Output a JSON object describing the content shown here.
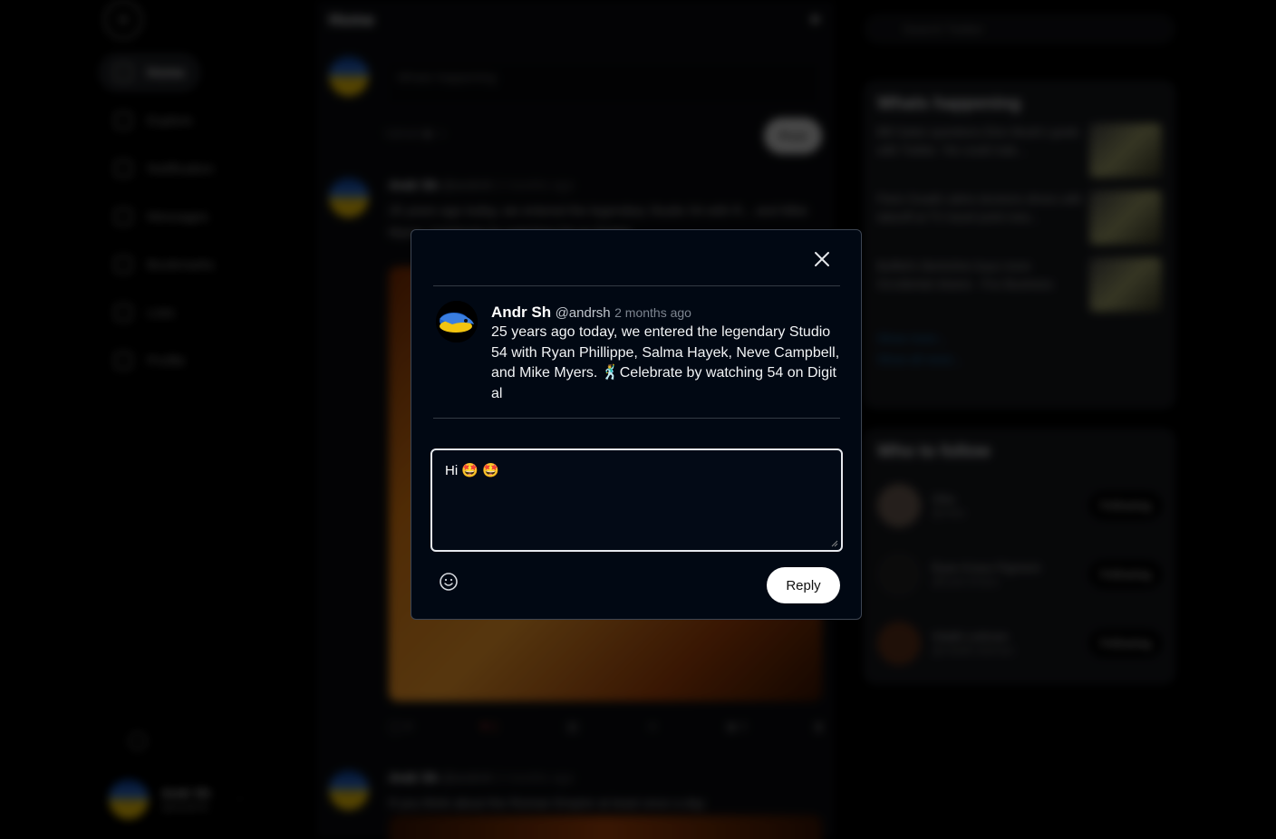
{
  "background": {
    "nav": {
      "items": [
        {
          "label": "Home",
          "icon": "home-icon"
        },
        {
          "label": "Explore",
          "icon": "hash-icon"
        },
        {
          "label": "Notification",
          "icon": "bell-icon"
        },
        {
          "label": "Messages",
          "icon": "mail-icon"
        },
        {
          "label": "Bookmarks",
          "icon": "bookmark-icon"
        },
        {
          "label": "Lists",
          "icon": "list-icon"
        },
        {
          "label": "Profile",
          "icon": "user-icon"
        }
      ],
      "account_name": "Andr Sh",
      "account_handle": "@andrsh"
    },
    "feed": {
      "title": "Home",
      "compose_placeholder": "Whats happening",
      "compose_tools_label": "Upload",
      "post_label": "Post",
      "tweet1_name": "Andr Sh",
      "tweet1_handle": "@andrsh",
      "tweet1_time": "2 months ago",
      "tweet1_text": "25 years ago today, we entered the legendary Studio 54 with R... and Mike Myers. Celebrate by watching 54 on Digital",
      "tweet1_replies": "4",
      "tweet1_likes": "1",
      "tweet1_views": "4",
      "tweet2_name": "Andr Sh",
      "tweet2_handle": "@andrsh",
      "tweet2_time": "2 months ago",
      "tweet2_text": "If you think about the Roman Empire at least once a day"
    },
    "right": {
      "search_placeholder": "Search Twitter",
      "trends_title": "Whats happening",
      "trends": [
        "Bill Gates questions Elon Musk's goals with Twitter. 'He could mak...",
        "Paris Ovadé calms tensions drives with takeoff at TV travel point new...",
        "Buffett's Berkshire buys more Occidental shares - Fox Business"
      ],
      "show_more": "Show more...",
      "show_all": "Show all news...",
      "follow_title": "Who to follow",
      "follow": [
        {
          "name": "Vika",
          "handle": "@vika",
          "button": "Following"
        },
        {
          "name": "Ryan Kraus Pigment",
          "handle": "@ryan.kraus",
          "button": "Following"
        },
        {
          "name": "Vitalik Leitman",
          "handle": "@vitalik.leitman",
          "button": "Following"
        }
      ]
    }
  },
  "modal": {
    "author_name": "Andr Sh",
    "author_handle": "@andrsh",
    "timestamp": "2 months ago",
    "tweet_text": "25 years ago today, we entered the legendary Studio 54 with Ryan Phillippe, Salma Hayek, Neve Campbell, and Mike Myers. 🕺Celebrate by watching 54 on Digital",
    "reply_value": "Hi 🤩 🤩",
    "reply_button": "Reply",
    "close_icon": "close-icon",
    "emoji_icon": "smiley-icon"
  }
}
